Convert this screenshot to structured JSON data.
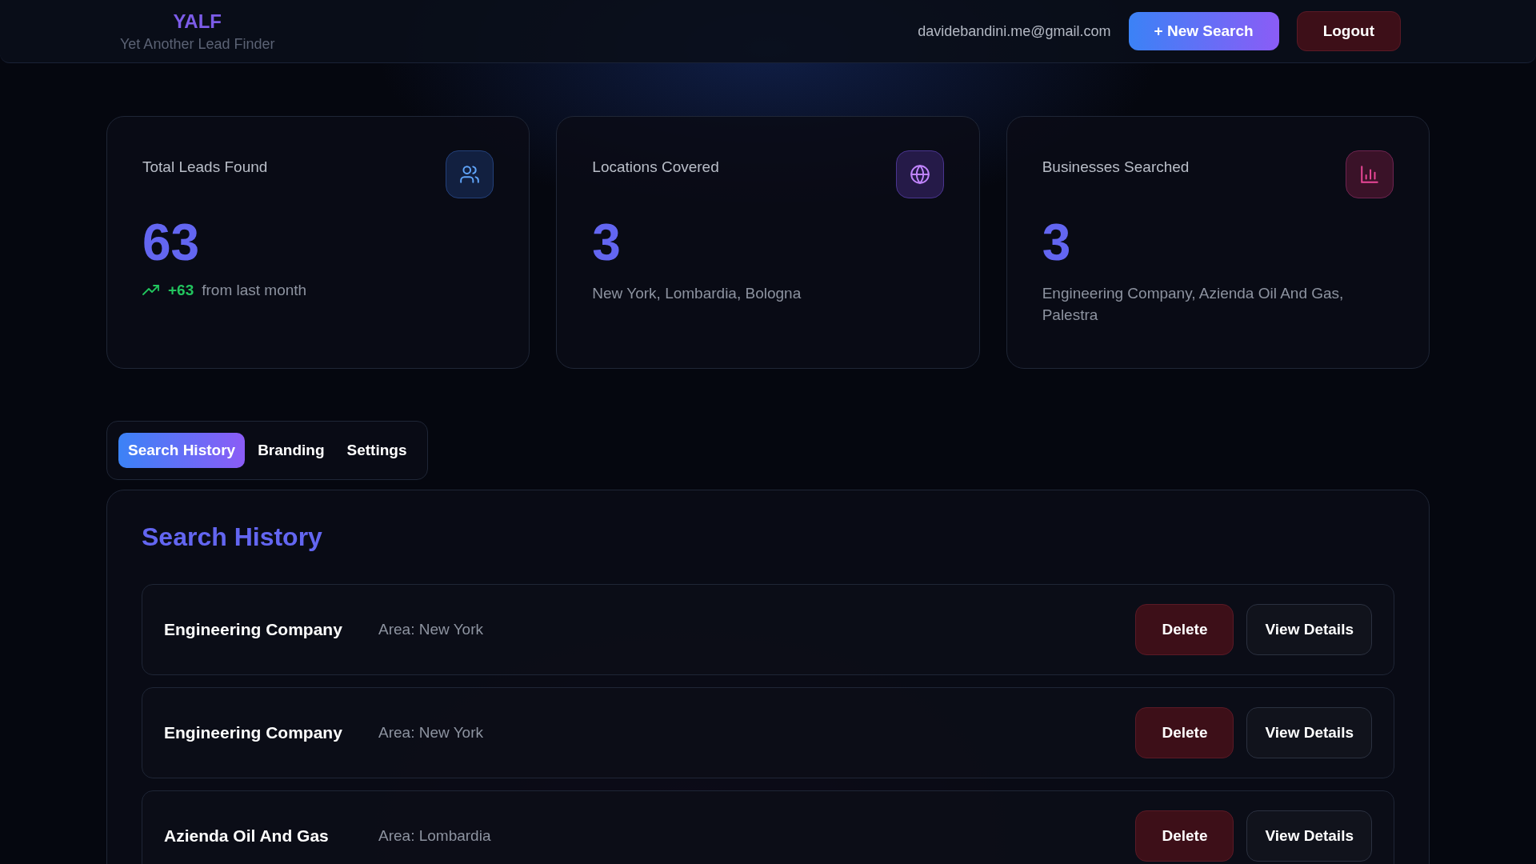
{
  "header": {
    "logo": "YALF",
    "tagline": "Yet Another Lead Finder",
    "email": "davidebandini.me@gmail.com",
    "new_search": "+ New Search",
    "logout": "Logout"
  },
  "stats": [
    {
      "kind": "users",
      "title": "Total Leads Found",
      "value": "63",
      "trend": {
        "delta": "+63",
        "text": "from last month"
      }
    },
    {
      "kind": "globe",
      "title": "Locations Covered",
      "value": "3",
      "detail": "New York, Lombardia, Bologna"
    },
    {
      "kind": "chart",
      "title": "Businesses Searched",
      "value": "3",
      "detail": "Engineering Company, Azienda Oil And Gas, Palestra"
    }
  ],
  "tabs": [
    {
      "label": "Search History",
      "selected": true
    },
    {
      "label": "Branding",
      "selected": false
    },
    {
      "label": "Settings",
      "selected": false
    }
  ],
  "history": {
    "title": "Search History",
    "rows": [
      {
        "business": "Engineering Company",
        "area": "Area: New York",
        "delete": "Delete",
        "view": "View Details"
      },
      {
        "business": "Engineering Company",
        "area": "Area: New York",
        "delete": "Delete",
        "view": "View Details"
      },
      {
        "business": "Azienda Oil And Gas",
        "area": "Area: Lombardia",
        "delete": "Delete",
        "view": "View Details"
      }
    ]
  }
}
